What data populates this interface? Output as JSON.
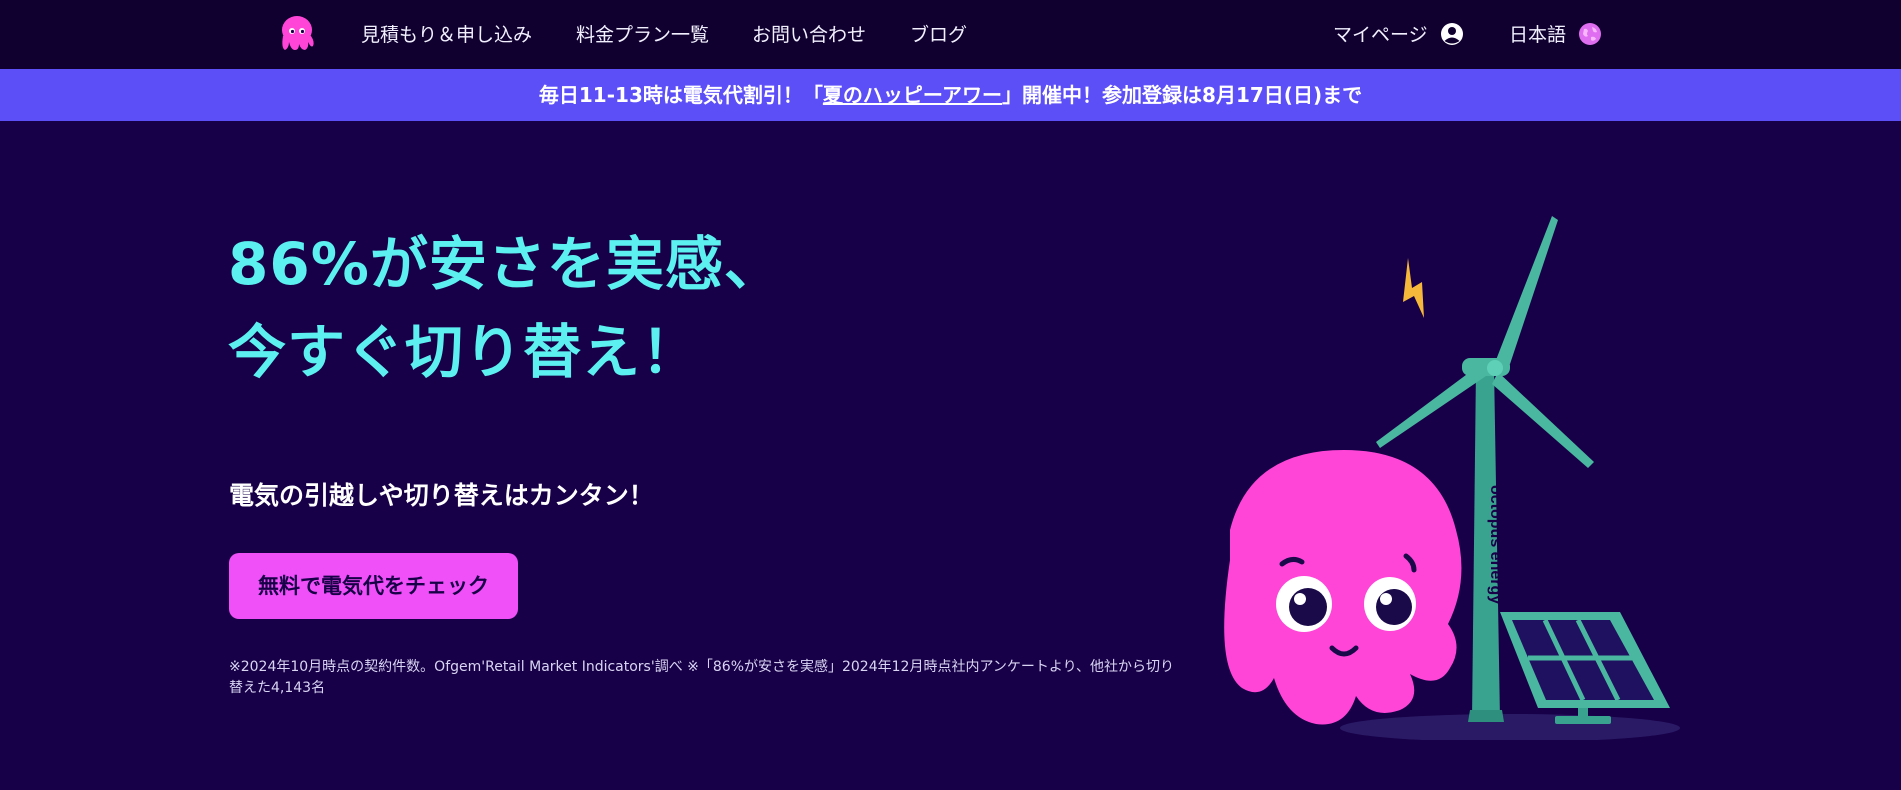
{
  "nav": {
    "links": [
      "見積もり＆申し込み",
      "料金プラン一覧",
      "お問い合わせ",
      "ブログ"
    ],
    "mypage": "マイページ",
    "language": "日本語"
  },
  "banner": {
    "prefix": "毎日11-13時は電気代割引！「",
    "link": "夏のハッピーアワー",
    "suffix": "」開催中！参加登録は8月17日(日)まで"
  },
  "hero": {
    "headline_line1": "86%が安さを実感、",
    "headline_line2": "今すぐ切り替え！",
    "subtitle": "電気の引越しや切り替えはカンタン！",
    "cta": "無料で電気代をチェック",
    "footnote": "※2024年10月時点の契約件数。Ofgem'Retail Market Indicators'調べ ※「86%が安さを実感」2024年12月時点社内アンケートより、他社から切り替えた4,143名"
  },
  "colors": {
    "background": "#180048",
    "nav_bg": "#100030",
    "banner_bg": "#5d4ff7",
    "headline": "#5cf0f0",
    "cta_bg": "#f050f8",
    "octopus": "#ff45d8",
    "turbine": "#4ab8a0"
  },
  "illustration": {
    "turbine_label": "octopus energy"
  }
}
